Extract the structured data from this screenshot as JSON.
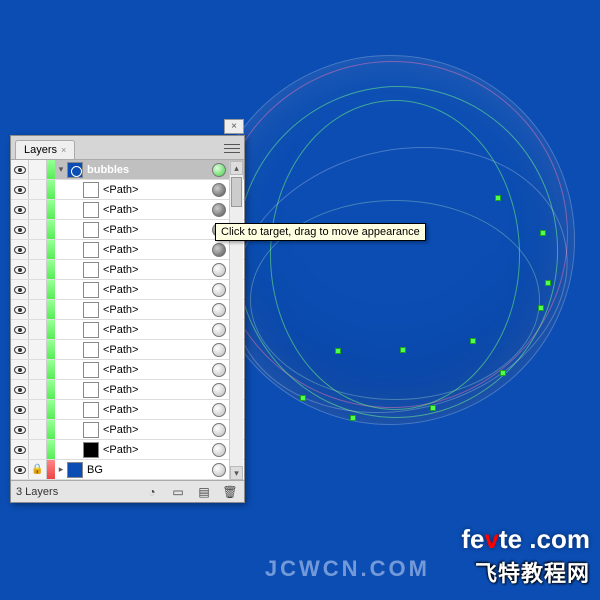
{
  "panel": {
    "tab_label": "Layers",
    "close_glyph": "×",
    "layer_name": "bubbles",
    "path_label": "<Path>",
    "bg_label": "BG",
    "footer_label": "3 Layers",
    "scroll_up": "▴",
    "scroll_down": "▾",
    "disclosure_open": "▾",
    "disclosure_closed": "▸",
    "tab_x": "×"
  },
  "tooltip": "Click to target, drag to move appearance",
  "icons": {
    "make_clip": "◔",
    "new_sublayer": "▭",
    "new_layer": "▤",
    "trash": "🗑",
    "target": "◎",
    "lock": "🔒"
  },
  "watermarks": {
    "site_prefix": "fe",
    "site_mid": "v",
    "site_suffix": "te .com",
    "chinese": "飞特教程网",
    "faint": "JCWCN.COM"
  }
}
